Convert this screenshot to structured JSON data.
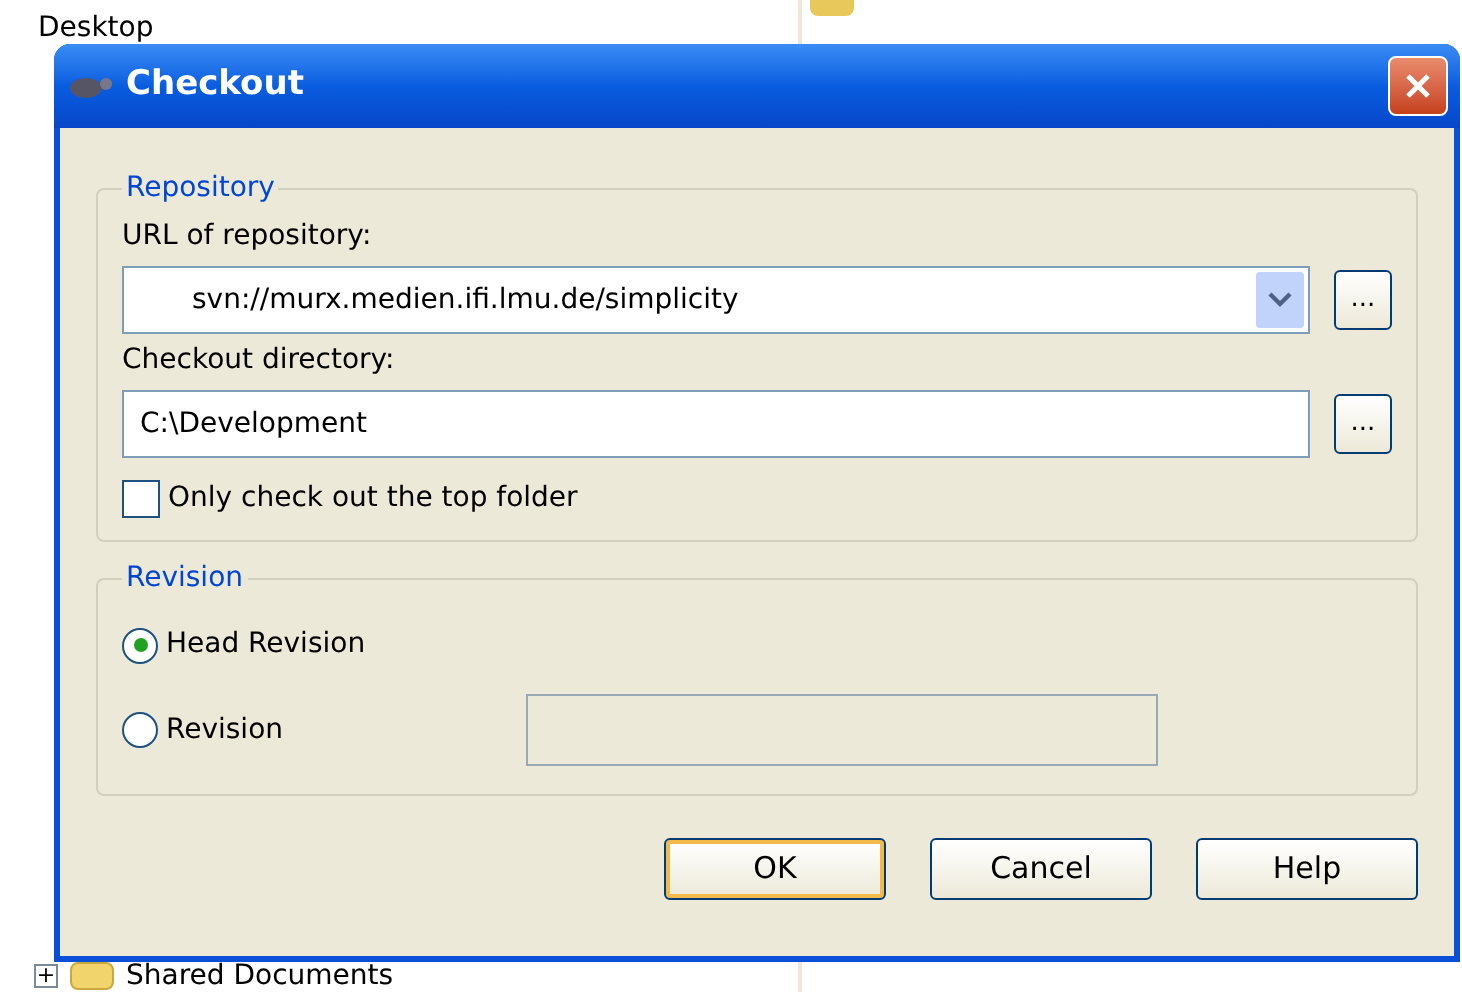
{
  "background": {
    "top_item": {
      "label": "Desktop"
    },
    "bottom_item": {
      "label": "Shared Documents",
      "expander": "+"
    }
  },
  "dialog": {
    "title": "Checkout",
    "repository": {
      "legend": "Repository",
      "url_label": "URL of repository:",
      "url_value": "svn://murx.medien.ifi.lmu.de/simplicity",
      "url_browse": "...",
      "dir_label": "Checkout directory:",
      "dir_value": "C:\\Development",
      "dir_browse": "...",
      "checkbox": {
        "label": "Only check out the top folder",
        "checked": false
      }
    },
    "revision": {
      "legend": "Revision",
      "options": [
        {
          "label": "Head Revision",
          "selected": true
        },
        {
          "label": "Revision",
          "selected": false
        }
      ]
    },
    "buttons": [
      {
        "label": "OK",
        "default": true
      },
      {
        "label": "Cancel",
        "default": false
      },
      {
        "label": "Help",
        "default": false
      }
    ]
  }
}
